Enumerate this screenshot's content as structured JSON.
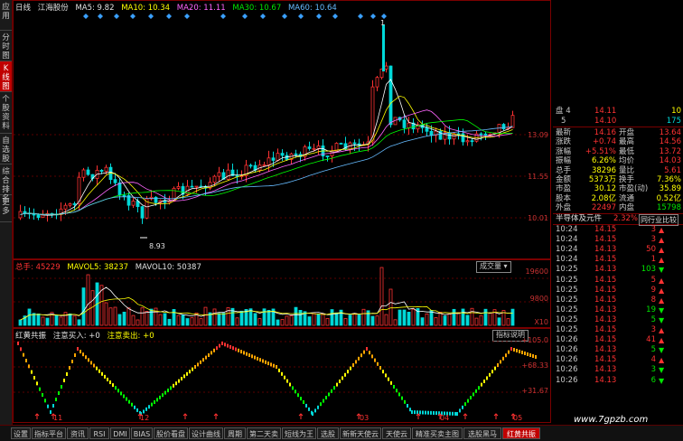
{
  "side_tabs": [
    {
      "label": "应用",
      "active": false
    },
    {
      "label": "分时图",
      "active": false
    },
    {
      "label": "K线图",
      "active": true
    },
    {
      "label": "个股资料",
      "active": false
    },
    {
      "label": "自选股",
      "active": false
    },
    {
      "label": "综合排名",
      "active": false
    },
    {
      "label": "更多",
      "active": false
    }
  ],
  "kline_header": {
    "period": "日线",
    "stock_name": "江海股份",
    "ma5": "MA5: 9.82",
    "ma10": "MA10: 10.34",
    "ma20": "MA20: 11.11",
    "ma30": "MA30: 10.67",
    "ma60": "MA60: 10.64"
  },
  "kline_axis": [
    "13.09",
    "11.55",
    "10.01"
  ],
  "kline_annotations": {
    "high_marker": "1",
    "low_marker": "8.93"
  },
  "volume_header": {
    "total": "总手: 45229",
    "mavol5": "MAVOL5: 38237",
    "mavol10": "MAVOL10: 50387",
    "dropdown": "成交量"
  },
  "volume_axis": [
    "19600",
    "9800",
    "X10"
  ],
  "indicator_header": {
    "name": "红黄共振",
    "buy": "注意买入: +0",
    "sell": "注意卖出: +0",
    "help_button": "指标说明"
  },
  "indicator_axis": [
    "+105.0",
    "+68.33",
    "+31.67"
  ],
  "date_markers": [
    "11",
    "12",
    "03",
    "04",
    "05"
  ],
  "bottom_tabs": [
    {
      "label": "设置",
      "active": false
    },
    {
      "label": "指标平台",
      "active": false
    },
    {
      "label": "资讯",
      "active": false
    },
    {
      "label": "RSI",
      "active": false
    },
    {
      "label": "DMI",
      "active": false
    },
    {
      "label": "BIAS",
      "active": false
    },
    {
      "label": "股价看盘",
      "active": false
    },
    {
      "label": "设计曲线",
      "active": false
    },
    {
      "label": "周期",
      "active": false
    },
    {
      "label": "第二天卖",
      "active": false
    },
    {
      "label": "短线为王",
      "active": false
    },
    {
      "label": "选股",
      "active": false
    },
    {
      "label": "新新天使云",
      "active": false
    },
    {
      "label": "天使云",
      "active": false
    },
    {
      "label": "精准买卖主图",
      "active": false
    },
    {
      "label": "选股黑马",
      "active": false
    },
    {
      "label": "红黄共振",
      "active": true
    }
  ],
  "order_book": {
    "sell_rows": [
      {
        "label": "盘 4",
        "price": "14.11",
        "vol": "10"
      },
      {
        "label": "5",
        "price": "14.10",
        "vol": "175"
      }
    ]
  },
  "quote": [
    {
      "l1": "最新",
      "v1": "14.16",
      "l2": "开盘",
      "v2": "13.64",
      "c1": "red",
      "c2": "red"
    },
    {
      "l1": "涨跌",
      "v1": "+0.74",
      "l2": "最高",
      "v2": "14.56",
      "c1": "red",
      "c2": "red"
    },
    {
      "l1": "涨幅",
      "v1": "+5.51%",
      "l2": "最低",
      "v2": "13.72",
      "c1": "red",
      "c2": "red"
    },
    {
      "l1": "振幅",
      "v1": "6.26%",
      "l2": "均价",
      "v2": "14.03",
      "c1": "yel",
      "c2": "red"
    },
    {
      "l1": "总手",
      "v1": "38296",
      "l2": "量比",
      "v2": "5.61",
      "c1": "yel",
      "c2": "red"
    },
    {
      "l1": "金额",
      "v1": "5373万",
      "l2": "换手",
      "v2": "7.36%",
      "c1": "yel",
      "c2": "yel"
    },
    {
      "l1": "市盈",
      "v1": "30.12",
      "l2": "市盈(动)",
      "v2": "35.89",
      "c1": "yel",
      "c2": "yel"
    },
    {
      "l1": "股本",
      "v1": "2.08亿",
      "l2": "流通",
      "v2": "0.52亿",
      "c1": "yel",
      "c2": "yel"
    },
    {
      "l1": "外盘",
      "v1": "22497",
      "l2": "内盘",
      "v2": "15798",
      "c1": "red",
      "c2": "grn"
    }
  ],
  "sector": {
    "name": "半导体及元件",
    "change": "2.32%",
    "compare": "同行业比较"
  },
  "ticks": [
    {
      "time": "10:24",
      "price": "14.15",
      "vol": "3",
      "dir": "up"
    },
    {
      "time": "10:24",
      "price": "14.15",
      "vol": "3",
      "dir": "up"
    },
    {
      "time": "10:24",
      "price": "14.13",
      "vol": "50",
      "dir": "up"
    },
    {
      "time": "10:24",
      "price": "14.15",
      "vol": "1",
      "dir": "up"
    },
    {
      "time": "10:25",
      "price": "14.13",
      "vol": "103",
      "dir": "down"
    },
    {
      "time": "10:25",
      "price": "14.15",
      "vol": "5",
      "dir": "up"
    },
    {
      "time": "10:25",
      "price": "14.15",
      "vol": "9",
      "dir": "up"
    },
    {
      "time": "10:25",
      "price": "14.15",
      "vol": "8",
      "dir": "up"
    },
    {
      "time": "10:25",
      "price": "14.13",
      "vol": "19",
      "dir": "down"
    },
    {
      "time": "10:25",
      "price": "14.13",
      "vol": "5",
      "dir": "down"
    },
    {
      "time": "10:25",
      "price": "14.15",
      "vol": "3",
      "dir": "up"
    },
    {
      "time": "10:26",
      "price": "14.15",
      "vol": "41",
      "dir": "up"
    },
    {
      "time": "10:26",
      "price": "14.13",
      "vol": "5",
      "dir": "down"
    },
    {
      "time": "10:26",
      "price": "14.15",
      "vol": "4",
      "dir": "up"
    },
    {
      "time": "10:26",
      "price": "14.13",
      "vol": "3",
      "dir": "down"
    },
    {
      "time": "10:26",
      "price": "14.13",
      "vol": "6",
      "dir": "down"
    }
  ],
  "watermark": "www.7gpzb.com",
  "colors": {
    "up": "#ff3232",
    "down": "#00d8d8",
    "ma5": "#ffffff",
    "ma10": "#ffff00",
    "ma20": "#ff66ff",
    "ma30": "#00ff00",
    "ma60": "#66bbff",
    "border": "#7a0000"
  }
}
